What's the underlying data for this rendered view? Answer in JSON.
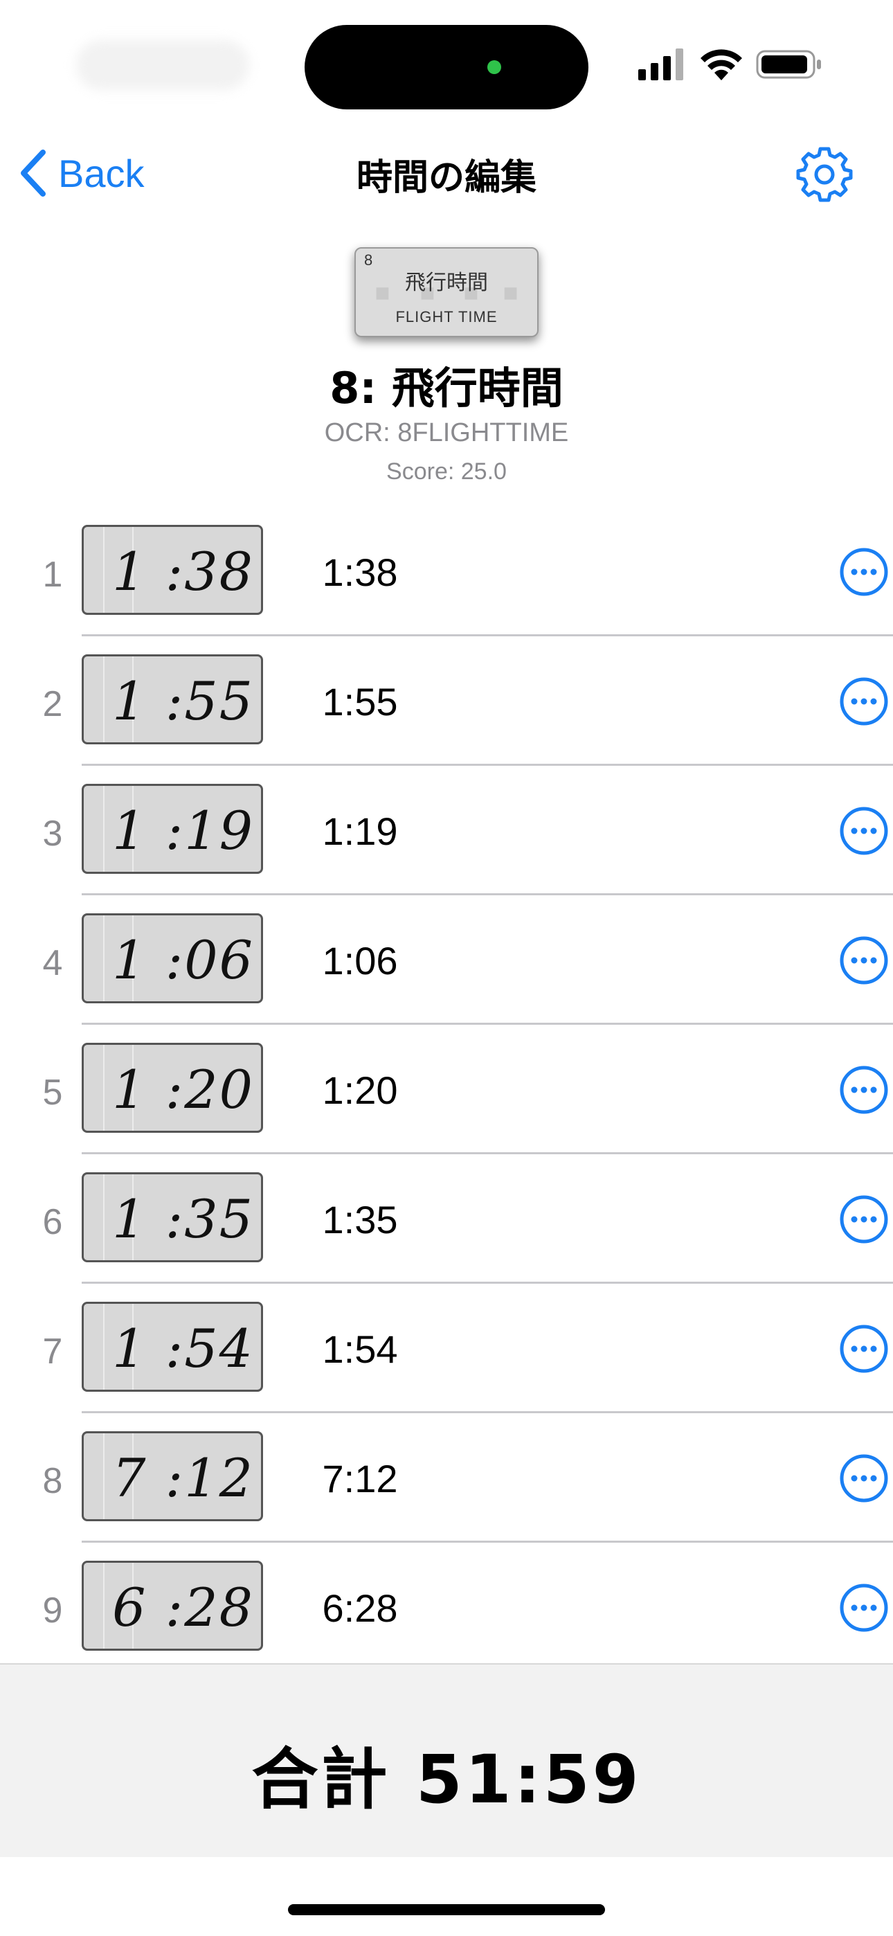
{
  "nav": {
    "back_label": "Back",
    "title": "時間の編集"
  },
  "header": {
    "thumb_number": "8",
    "thumb_jp": "飛行時間",
    "thumb_en": "FLIGHT TIME",
    "title": "8: 飛行時間",
    "ocr": "OCR: 8FLIGHTTIME",
    "score": "Score: 25.0"
  },
  "rows": [
    {
      "index": "1",
      "handwritten": "1 :38",
      "value": "1:38"
    },
    {
      "index": "2",
      "handwritten": "1 :55",
      "value": "1:55"
    },
    {
      "index": "3",
      "handwritten": "1 :19",
      "value": "1:19"
    },
    {
      "index": "4",
      "handwritten": "1 :06",
      "value": "1:06"
    },
    {
      "index": "5",
      "handwritten": "1 :20",
      "value": "1:20"
    },
    {
      "index": "6",
      "handwritten": "1 :35",
      "value": "1:35"
    },
    {
      "index": "7",
      "handwritten": "1 :54",
      "value": "1:54"
    },
    {
      "index": "8",
      "handwritten": "7 :12",
      "value": "7:12"
    },
    {
      "index": "9",
      "handwritten": "6 :28",
      "value": "6:28"
    }
  ],
  "footer": {
    "total": "合計 51:59"
  },
  "icons": {
    "back": "chevron-left-icon",
    "settings": "gear-icon",
    "more": "ellipsis-circle-icon",
    "signal": "cellular-signal-icon",
    "wifi": "wifi-icon",
    "battery": "battery-icon"
  },
  "colors": {
    "accent": "#1a7ff3",
    "secondary_text": "#8a8a8e",
    "footer_bg": "#f2f2f2",
    "island_dot": "#2fc24a"
  }
}
